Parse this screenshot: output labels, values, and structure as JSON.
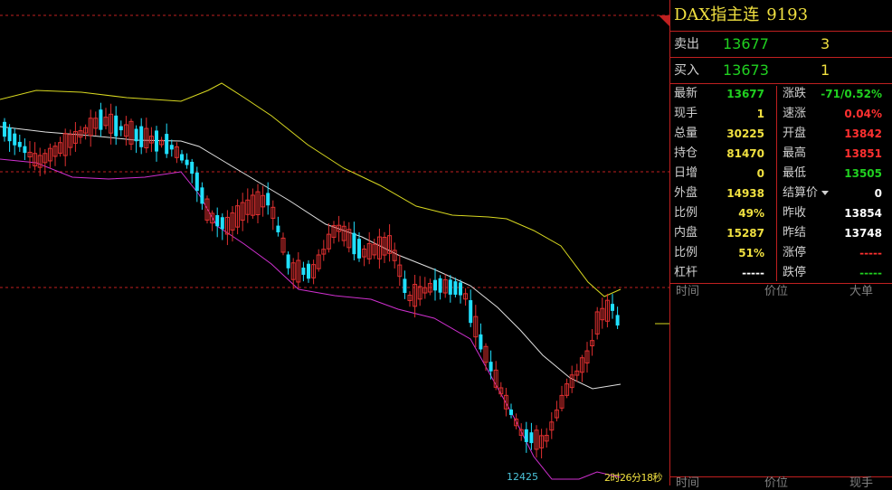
{
  "chart": {
    "low_label": "12425",
    "countdown": "2时26分18秒",
    "colors": {
      "up": "#e03030",
      "down": "#20e0ff",
      "upper_band": "#d8d820",
      "mid_band": "#e0e0e0",
      "lower_band": "#d030d0",
      "ref_line": "#c02020"
    }
  },
  "panel": {
    "title": "DAX指主连",
    "code": "9193",
    "sell": {
      "label": "卖出",
      "price": "13677",
      "volume": "3"
    },
    "buy": {
      "label": "买入",
      "price": "13673",
      "volume": "1"
    },
    "stats": [
      {
        "label": "最新",
        "value": "13677",
        "value_color": "green",
        "label2": "涨跌",
        "value2": "-71/0.52%",
        "value2_color": "green"
      },
      {
        "label": "现手",
        "value": "1",
        "value_color": "yellow",
        "label2": "速涨",
        "value2": "0.04%",
        "value2_color": "red"
      },
      {
        "label": "总量",
        "value": "30225",
        "value_color": "yellow",
        "label2": "开盘",
        "value2": "13842",
        "value2_color": "red"
      },
      {
        "label": "持仓",
        "value": "81470",
        "value_color": "yellow",
        "label2": "最高",
        "value2": "13851",
        "value2_color": "red"
      },
      {
        "label": "日增",
        "value": "0",
        "value_color": "yellow",
        "label2": "最低",
        "value2": "13505",
        "value2_color": "green"
      },
      {
        "label": "外盘",
        "value": "14938",
        "value_color": "yellow",
        "label2": "结算价",
        "value2": "0",
        "value2_color": "white",
        "dropdown": true
      },
      {
        "label": "比例",
        "value": "49%",
        "value_color": "yellow",
        "label2": "昨收",
        "value2": "13854",
        "value2_color": "white"
      },
      {
        "label": "内盘",
        "value": "15287",
        "value_color": "yellow",
        "label2": "昨结",
        "value2": "13748",
        "value2_color": "white"
      },
      {
        "label": "比例",
        "value": "51%",
        "value_color": "yellow",
        "label2": "涨停",
        "value2": "-----",
        "value2_color": "red"
      },
      {
        "label": "杠杆",
        "value": "-----",
        "value_color": "white",
        "label2": "跌停",
        "value2": "-----",
        "value2_color": "green"
      }
    ],
    "tick_header": {
      "time": "时间",
      "price": "价位",
      "volume": "大单"
    },
    "tick_footer": {
      "time": "时间",
      "price": "价位",
      "volume": "现手"
    }
  }
}
